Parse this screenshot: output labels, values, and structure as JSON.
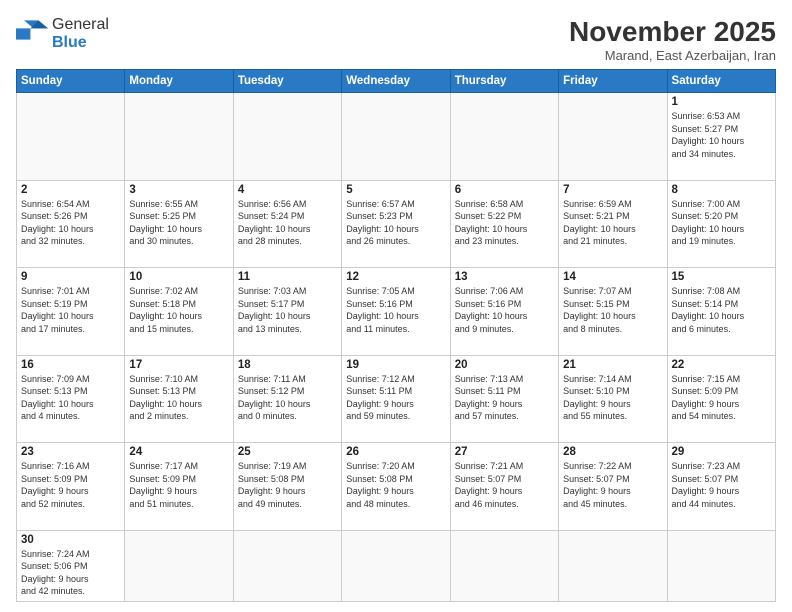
{
  "logo": {
    "line1": "General",
    "line2": "Blue"
  },
  "title": "November 2025",
  "location": "Marand, East Azerbaijan, Iran",
  "weekdays": [
    "Sunday",
    "Monday",
    "Tuesday",
    "Wednesday",
    "Thursday",
    "Friday",
    "Saturday"
  ],
  "weeks": [
    [
      {
        "day": "",
        "info": ""
      },
      {
        "day": "",
        "info": ""
      },
      {
        "day": "",
        "info": ""
      },
      {
        "day": "",
        "info": ""
      },
      {
        "day": "",
        "info": ""
      },
      {
        "day": "",
        "info": ""
      },
      {
        "day": "1",
        "info": "Sunrise: 6:53 AM\nSunset: 5:27 PM\nDaylight: 10 hours\nand 34 minutes."
      }
    ],
    [
      {
        "day": "2",
        "info": "Sunrise: 6:54 AM\nSunset: 5:26 PM\nDaylight: 10 hours\nand 32 minutes."
      },
      {
        "day": "3",
        "info": "Sunrise: 6:55 AM\nSunset: 5:25 PM\nDaylight: 10 hours\nand 30 minutes."
      },
      {
        "day": "4",
        "info": "Sunrise: 6:56 AM\nSunset: 5:24 PM\nDaylight: 10 hours\nand 28 minutes."
      },
      {
        "day": "5",
        "info": "Sunrise: 6:57 AM\nSunset: 5:23 PM\nDaylight: 10 hours\nand 26 minutes."
      },
      {
        "day": "6",
        "info": "Sunrise: 6:58 AM\nSunset: 5:22 PM\nDaylight: 10 hours\nand 23 minutes."
      },
      {
        "day": "7",
        "info": "Sunrise: 6:59 AM\nSunset: 5:21 PM\nDaylight: 10 hours\nand 21 minutes."
      },
      {
        "day": "8",
        "info": "Sunrise: 7:00 AM\nSunset: 5:20 PM\nDaylight: 10 hours\nand 19 minutes."
      }
    ],
    [
      {
        "day": "9",
        "info": "Sunrise: 7:01 AM\nSunset: 5:19 PM\nDaylight: 10 hours\nand 17 minutes."
      },
      {
        "day": "10",
        "info": "Sunrise: 7:02 AM\nSunset: 5:18 PM\nDaylight: 10 hours\nand 15 minutes."
      },
      {
        "day": "11",
        "info": "Sunrise: 7:03 AM\nSunset: 5:17 PM\nDaylight: 10 hours\nand 13 minutes."
      },
      {
        "day": "12",
        "info": "Sunrise: 7:05 AM\nSunset: 5:16 PM\nDaylight: 10 hours\nand 11 minutes."
      },
      {
        "day": "13",
        "info": "Sunrise: 7:06 AM\nSunset: 5:16 PM\nDaylight: 10 hours\nand 9 minutes."
      },
      {
        "day": "14",
        "info": "Sunrise: 7:07 AM\nSunset: 5:15 PM\nDaylight: 10 hours\nand 8 minutes."
      },
      {
        "day": "15",
        "info": "Sunrise: 7:08 AM\nSunset: 5:14 PM\nDaylight: 10 hours\nand 6 minutes."
      }
    ],
    [
      {
        "day": "16",
        "info": "Sunrise: 7:09 AM\nSunset: 5:13 PM\nDaylight: 10 hours\nand 4 minutes."
      },
      {
        "day": "17",
        "info": "Sunrise: 7:10 AM\nSunset: 5:13 PM\nDaylight: 10 hours\nand 2 minutes."
      },
      {
        "day": "18",
        "info": "Sunrise: 7:11 AM\nSunset: 5:12 PM\nDaylight: 10 hours\nand 0 minutes."
      },
      {
        "day": "19",
        "info": "Sunrise: 7:12 AM\nSunset: 5:11 PM\nDaylight: 9 hours\nand 59 minutes."
      },
      {
        "day": "20",
        "info": "Sunrise: 7:13 AM\nSunset: 5:11 PM\nDaylight: 9 hours\nand 57 minutes."
      },
      {
        "day": "21",
        "info": "Sunrise: 7:14 AM\nSunset: 5:10 PM\nDaylight: 9 hours\nand 55 minutes."
      },
      {
        "day": "22",
        "info": "Sunrise: 7:15 AM\nSunset: 5:09 PM\nDaylight: 9 hours\nand 54 minutes."
      }
    ],
    [
      {
        "day": "23",
        "info": "Sunrise: 7:16 AM\nSunset: 5:09 PM\nDaylight: 9 hours\nand 52 minutes."
      },
      {
        "day": "24",
        "info": "Sunrise: 7:17 AM\nSunset: 5:09 PM\nDaylight: 9 hours\nand 51 minutes."
      },
      {
        "day": "25",
        "info": "Sunrise: 7:19 AM\nSunset: 5:08 PM\nDaylight: 9 hours\nand 49 minutes."
      },
      {
        "day": "26",
        "info": "Sunrise: 7:20 AM\nSunset: 5:08 PM\nDaylight: 9 hours\nand 48 minutes."
      },
      {
        "day": "27",
        "info": "Sunrise: 7:21 AM\nSunset: 5:07 PM\nDaylight: 9 hours\nand 46 minutes."
      },
      {
        "day": "28",
        "info": "Sunrise: 7:22 AM\nSunset: 5:07 PM\nDaylight: 9 hours\nand 45 minutes."
      },
      {
        "day": "29",
        "info": "Sunrise: 7:23 AM\nSunset: 5:07 PM\nDaylight: 9 hours\nand 44 minutes."
      }
    ],
    [
      {
        "day": "30",
        "info": "Sunrise: 7:24 AM\nSunset: 5:06 PM\nDaylight: 9 hours\nand 42 minutes."
      },
      {
        "day": "",
        "info": ""
      },
      {
        "day": "",
        "info": ""
      },
      {
        "day": "",
        "info": ""
      },
      {
        "day": "",
        "info": ""
      },
      {
        "day": "",
        "info": ""
      },
      {
        "day": "",
        "info": ""
      }
    ]
  ]
}
